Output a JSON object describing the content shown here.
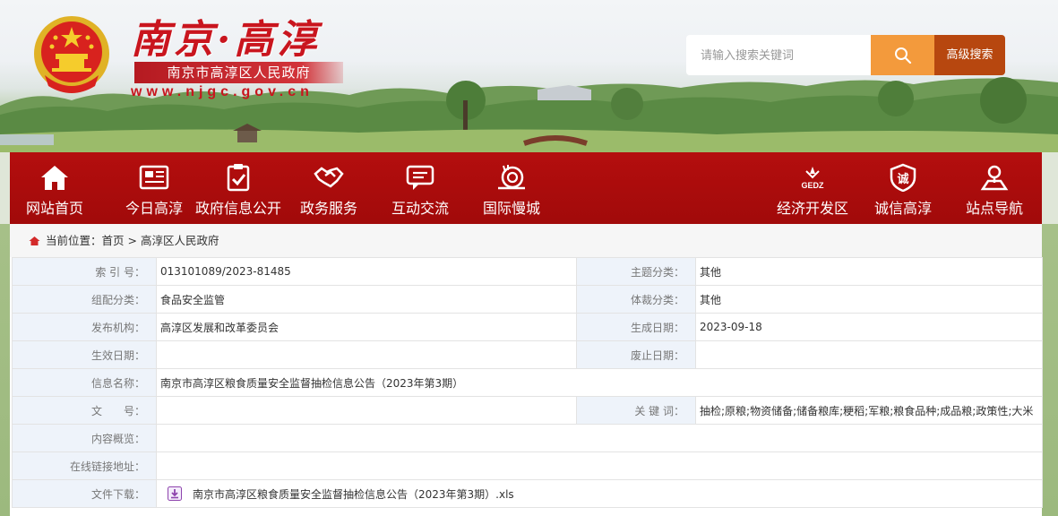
{
  "header": {
    "title": "南京·高淳",
    "subtitle": "南京市高淳区人民政府",
    "url": "www.njgc.gov.cn",
    "search": {
      "placeholder": "请输入搜索关键词",
      "advanced_label": "高级搜索"
    }
  },
  "nav": {
    "left": [
      {
        "label": "网站首页",
        "icon": "home-icon"
      },
      {
        "label": "今日高淳",
        "icon": "newspaper-icon"
      },
      {
        "label": "政府信息公开",
        "icon": "checklist-icon"
      },
      {
        "label": "政务服务",
        "icon": "handshake-icon"
      },
      {
        "label": "互动交流",
        "icon": "chat-icon"
      },
      {
        "label": "国际慢城",
        "icon": "snail-icon"
      }
    ],
    "right": [
      {
        "label": "经济开发区",
        "icon": "gedz-logo-icon",
        "badge": "GEDZ"
      },
      {
        "label": "诚信高淳",
        "icon": "integrity-shield-icon",
        "badge": "诚"
      },
      {
        "label": "站点导航",
        "icon": "location-person-icon"
      }
    ]
  },
  "breadcrumb": {
    "prefix": "当前位置：",
    "home": "首页",
    "separator": " > ",
    "current": "高淳区人民政府"
  },
  "meta": {
    "index_no_label": "索 引 号：",
    "index_no": "013101089/2023-81485",
    "topic_label": "主题分类：",
    "topic": "其他",
    "category_label": "组配分类：",
    "category": "食品安全监管",
    "genre_label": "体裁分类：",
    "genre": "其他",
    "publisher_label": "发布机构：",
    "publisher": "高淳区发展和改革委员会",
    "created_label": "生成日期：",
    "created": "2023-09-18",
    "effective_label": "生效日期：",
    "effective": "",
    "abolished_label": "废止日期：",
    "abolished": "",
    "name_label": "信息名称：",
    "name": "南京市高淳区粮食质量安全监督抽检信息公告（2023年第3期）",
    "docno_label": "文　　号：",
    "docno": "",
    "keywords_label": "关 键 词：",
    "keywords": "抽检;原粮;物资储备;储备粮库;粳稻;军粮;粮食品种;成品粮;政策性;大米",
    "summary_label": "内容概览：",
    "summary": "",
    "link_label": "在线链接地址：",
    "link": "",
    "download_label": "文件下载：",
    "download_file": "南京市高淳区粮食质量安全监督抽检信息公告（2023年第3期）.xls"
  },
  "colors": {
    "brand_red": "#a80c0c",
    "search_orange": "#f39a3c",
    "advanced_brown": "#b7470f",
    "label_bg": "#eef3fa"
  }
}
